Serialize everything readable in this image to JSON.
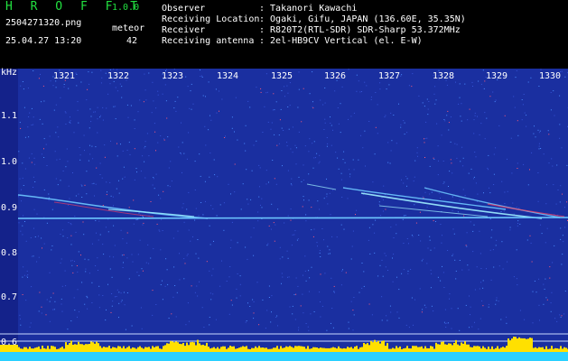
{
  "header": {
    "logo": "H R O F F T",
    "version": "1.0.0",
    "filename": "2504271320.png",
    "datetime": "25.04.27 13:20",
    "meteor_label": "meteor",
    "meteor_count": "42",
    "info": [
      {
        "key": "Observer",
        "value": ": Takanori Kawachi"
      },
      {
        "key": "Receiving Location",
        "value": ": Ogaki, Gifu, JAPAN (136.60E, 35.35N)"
      },
      {
        "key": "Receiver",
        "value": ": R820T2(RTL-SDR) SDR-Sharp 53.372MHz"
      },
      {
        "key": "Receiving antenna",
        "value": ": 2el-HB9CV Vertical (el. E-W)"
      }
    ]
  },
  "spectrogram": {
    "y_unit": "kHz",
    "y_ticks": [
      "1.1",
      "1.0",
      "0.9",
      "0.8",
      "0.7",
      "0.6"
    ],
    "x_ticks": [
      "1321",
      "1322",
      "1323",
      "1324",
      "1325",
      "1326",
      "1327",
      "1328",
      "1329",
      "1330"
    ],
    "colors": {
      "background": "#1a2fa0",
      "carrier": "#6ec8ff",
      "meteor": "#9ff0ff",
      "hot": "#ff4060",
      "signal_bar": "#ffe000",
      "base": "#2ad0ff",
      "grid_line": "#c8d8ff"
    }
  }
}
